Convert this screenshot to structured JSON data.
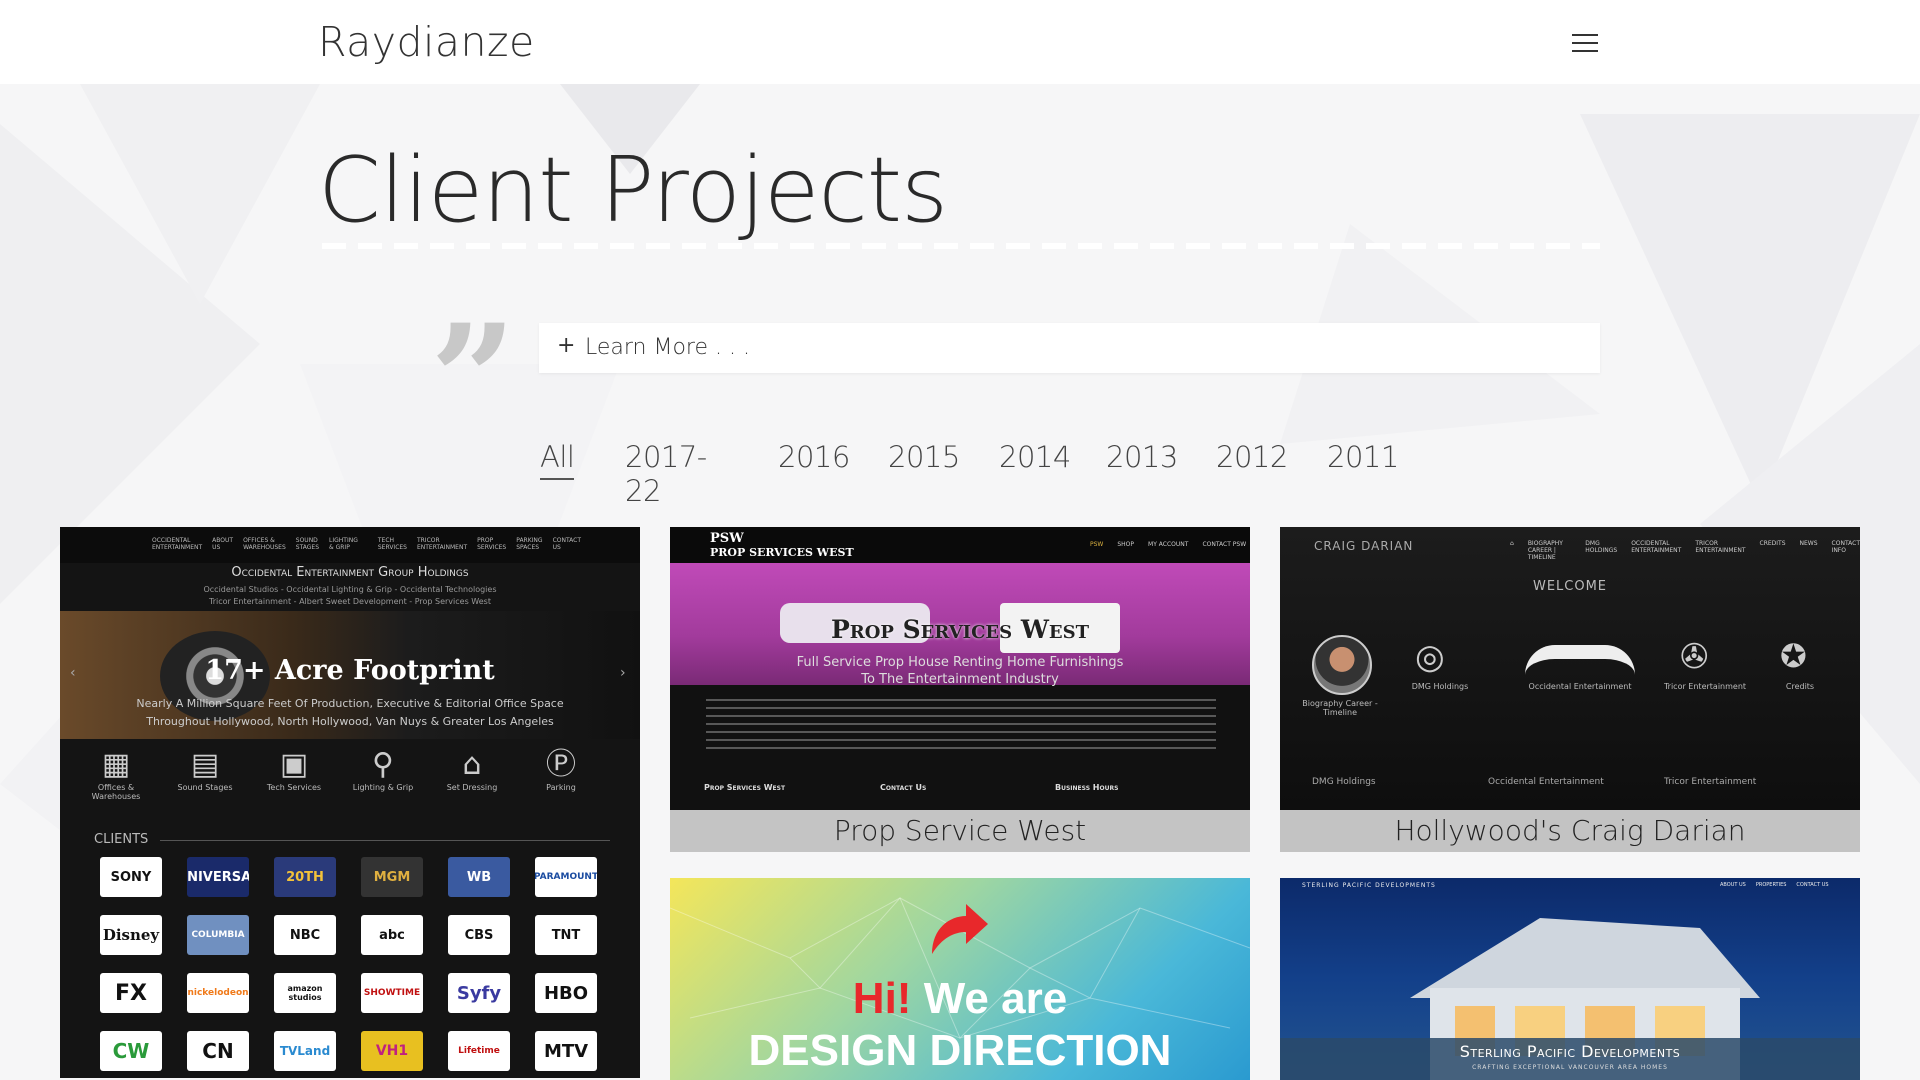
{
  "site": {
    "logo": "Raydianze"
  },
  "page": {
    "title": "Client Projects",
    "quote_glyph": "”",
    "learn_more": {
      "icon": "+",
      "label": "Learn More . . ."
    }
  },
  "filters": [
    "All",
    "2017-22",
    "2016",
    "2015",
    "2014",
    "2013",
    "2012",
    "2011"
  ],
  "cards": {
    "oeg": {
      "nav": [
        "OCCIDENTAL ENTERTAINMENT",
        "ABOUT US",
        "OFFICES & WAREHOUSES",
        "SOUND STAGES",
        "LIGHTING & GRIP",
        "TECH SERVICES",
        "TRICOR ENTERTAINMENT",
        "PROP SERVICES",
        "PARKING SPACES",
        "CONTACT US"
      ],
      "heading": "Occidental Entertainment Group Holdings",
      "sub1": "Occidental Studios - Occidental Lighting & Grip - Occidental Technologies",
      "sub2": "Tricor Entertainment - Albert Sweet Development - Prop Services West",
      "slide_title": "17+ Acre Footprint",
      "slide_text1": "Nearly A Million Square Feet Of Production, Executive & Editorial Office Space",
      "slide_text2": "Throughout Hollywood, North Hollywood, Van Nuys & Greater Los Angeles",
      "services": [
        "Offices & Warehouses",
        "Sound Stages",
        "Tech Services",
        "Lighting & Grip",
        "Set Dressing",
        "Parking"
      ],
      "clients_label": "CLIENTS",
      "logos": [
        "SONY",
        "UNIVERSAL",
        "20TH",
        "MGM",
        "WB",
        "PARAMOUNT",
        "Disney",
        "COLUMBIA",
        "NBC",
        "abc",
        "CBS",
        "TNT",
        "FX",
        "nickelodeon",
        "amazon studios",
        "SHOWTIME",
        "Syfy",
        "HBO",
        "CW",
        "CN",
        "TVLand",
        "VH1",
        "Lifetime",
        "MTV"
      ]
    },
    "psw": {
      "brand1": "PSW",
      "brand2": "PROP SERVICES WEST",
      "nav": [
        "PSW",
        "SHOP",
        "MY ACCOUNT",
        "CONTACT PSW"
      ],
      "hero_title": "Prop Services West",
      "hero_sub1": "Full Service Prop House Renting Home Furnishings",
      "hero_sub2": "To The Entertainment Industry",
      "footer_heads": [
        "Prop Services West",
        "Contact Us",
        "Business Hours"
      ],
      "caption": "Prop Service West"
    },
    "craig": {
      "brand": "CRAIG DARIAN",
      "nav": [
        "BIOGRAPHY CAREER | TIMELINE",
        "DMG HOLDINGS",
        "OCCIDENTAL ENTERTAINMENT",
        "TRICOR ENTERTAINMENT",
        "CREDITS",
        "NEWS",
        "CONTACT INFO"
      ],
      "welcome": "WELCOME",
      "items": [
        "Biography Career - Timeline",
        "DMG Holdings",
        "Occidental Entertainment",
        "Tricor Entertainment",
        "Credits"
      ],
      "footer": [
        "DMG Holdings",
        "Occidental Entertainment",
        "Tricor Entertainment"
      ],
      "caption": "Hollywood's Craig Darian"
    },
    "design": {
      "hi": "Hi!",
      "we_are": "We are",
      "line2": "DESIGN DIRECTION"
    },
    "sterling": {
      "brand": "STERLING PACIFIC DEVELOPMENTS",
      "nav": [
        "ABOUT US",
        "PROPERTIES",
        "CONTACT US"
      ],
      "title": "Sterling Pacific Developments",
      "tagline": "CRAFTING EXCEPTIONAL VANCOUVER AREA HOMES"
    }
  },
  "colors": {
    "page_bg": "#f6f6f7",
    "header_bg": "#ffffff",
    "accent_red": "#e8282b",
    "psw_purple": "#b03aa8"
  }
}
